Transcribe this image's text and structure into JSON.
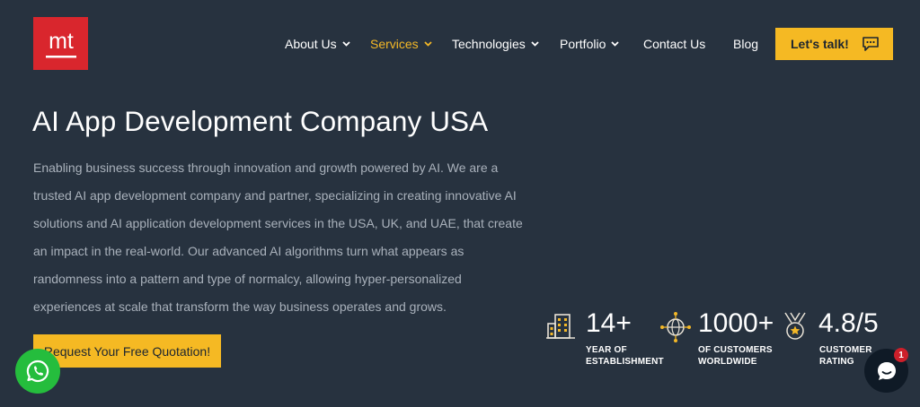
{
  "brand": {
    "logo_text": "mt",
    "logo_color": "#d9262d"
  },
  "nav": {
    "items": [
      {
        "label": "About Us",
        "has_dropdown": true
      },
      {
        "label": "Services",
        "has_dropdown": true,
        "active": true
      },
      {
        "label": "Technologies",
        "has_dropdown": true
      },
      {
        "label": "Portfolio",
        "has_dropdown": true
      },
      {
        "label": "Contact Us",
        "has_dropdown": false
      },
      {
        "label": "Blog",
        "has_dropdown": false
      }
    ],
    "cta_label": "Let's talk!",
    "cta_icon": "chat-bubble-icon"
  },
  "hero": {
    "title": "AI App Development Company USA",
    "description": "Enabling business success through innovation and growth powered by AI. We are a trusted AI app development company and partner, specializing in creating innovative AI solutions and AI application development services in the USA, UK, and UAE, that create an impact in the real-world. Our advanced AI algorithms turn what appears as randomness into a pattern and type of normalcy, allowing hyper-personalized experiences at scale that transform the way business operates and grows.",
    "button_label": "Request Your Free Quotation!"
  },
  "stats": [
    {
      "value": "14+",
      "label_line1": "YEAR OF",
      "label_line2": "ESTABLISHMENT",
      "icon": "building-icon"
    },
    {
      "value": "1000+",
      "label_line1": "OF CUSTOMERS",
      "label_line2": "WORLDWIDE",
      "icon": "globe-network-icon"
    },
    {
      "value": "4.8/5",
      "label_line1": "CUSTOMER",
      "label_line2": "RATING",
      "icon": "medal-icon"
    }
  ],
  "floating": {
    "whatsapp_icon": "whatsapp-icon",
    "chat_icon": "chat-icon",
    "chat_badge_count": "1"
  },
  "colors": {
    "background": "#27323f",
    "accent": "#f5b923",
    "active_nav": "#f4b827",
    "muted_text": "#a9b1bb",
    "whatsapp": "#25bd3d",
    "badge": "#cc1f2a"
  }
}
